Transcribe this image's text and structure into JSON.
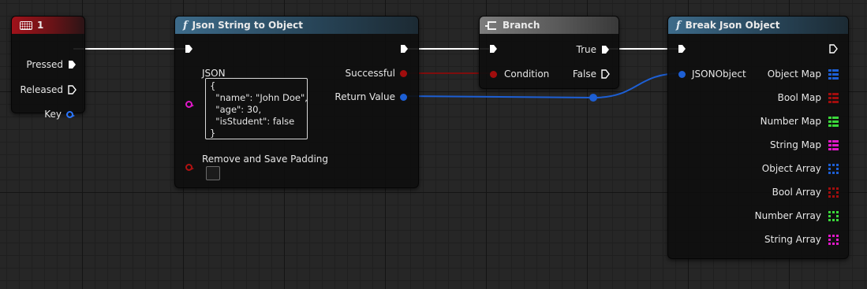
{
  "colors": {
    "exec": "#ffffff",
    "object": "#1d5fd4",
    "bool": "#a10d0d",
    "number": "#3bd83b",
    "string": "#e018c8"
  },
  "key_node": {
    "title": "1",
    "icon": "keyboard-icon",
    "pins": {
      "pressed": "Pressed",
      "released": "Released",
      "key": "Key"
    }
  },
  "json_node": {
    "title": "Json String to Object",
    "icon": "function-icon",
    "json_label": "JSON",
    "json_value": "{\n  \"name\": \"John Doe\",\n  \"age\": 30,\n  \"isStudent\": false\n}",
    "padding_label": "Remove and Save Padding",
    "padding_checked": false,
    "out_successful": "Successful",
    "out_return": "Return Value"
  },
  "branch_node": {
    "title": "Branch",
    "icon": "branch-icon",
    "condition": "Condition",
    "true_label": "True",
    "false_label": "False"
  },
  "break_node": {
    "title": "Break Json Object",
    "icon": "function-icon",
    "input": "JSONObject",
    "outputs": [
      {
        "label": "Object Map",
        "type": "object",
        "container": "map"
      },
      {
        "label": "Bool Map",
        "type": "bool",
        "container": "map"
      },
      {
        "label": "Number Map",
        "type": "number",
        "container": "map"
      },
      {
        "label": "String Map",
        "type": "string",
        "container": "map"
      },
      {
        "label": "Object Array",
        "type": "object",
        "container": "array"
      },
      {
        "label": "Bool Array",
        "type": "bool",
        "container": "array"
      },
      {
        "label": "Number Array",
        "type": "number",
        "container": "array"
      },
      {
        "label": "String Array",
        "type": "string",
        "container": "array"
      }
    ]
  }
}
